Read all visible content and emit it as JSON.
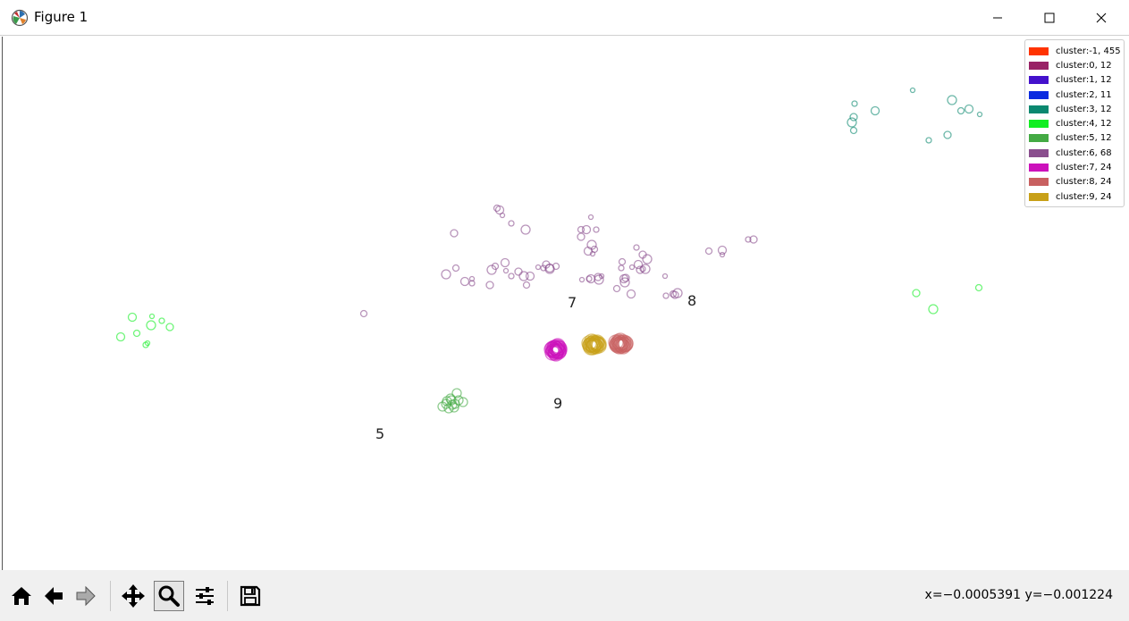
{
  "window": {
    "title": "Figure 1",
    "app_icon": "matplotlib-icon",
    "controls": [
      "minimize-icon",
      "maximize-icon",
      "close-icon"
    ]
  },
  "legend": [
    {
      "label": "cluster:-1, 455",
      "color": "#ff3300"
    },
    {
      "label": "cluster:0, 12",
      "color": "#992266"
    },
    {
      "label": "cluster:1, 12",
      "color": "#4411cc"
    },
    {
      "label": "cluster:2, 11",
      "color": "#0a2be0"
    },
    {
      "label": "cluster:3, 12",
      "color": "#0b8870"
    },
    {
      "label": "cluster:4, 12",
      "color": "#11ee22"
    },
    {
      "label": "cluster:5, 12",
      "color": "#44aa44"
    },
    {
      "label": "cluster:6, 68",
      "color": "#8a4e8e"
    },
    {
      "label": "cluster:7, 24",
      "color": "#cc11bb"
    },
    {
      "label": "cluster:8, 24",
      "color": "#c86060"
    },
    {
      "label": "cluster:9, 24",
      "color": "#c8a018"
    }
  ],
  "cluster_labels": [
    {
      "text": "7",
      "name": "cluster-label-7"
    },
    {
      "text": "8",
      "name": "cluster-label-8"
    },
    {
      "text": "9",
      "name": "cluster-label-9"
    },
    {
      "text": "5",
      "name": "cluster-label-5"
    }
  ],
  "toolbar": {
    "buttons": [
      "home-icon",
      "back-icon",
      "forward-icon",
      "pan-icon",
      "zoom-icon",
      "configure-icon",
      "save-icon"
    ],
    "active": "zoom-icon"
  },
  "status": {
    "coords": "x=−0.0005391 y=−0.001224"
  },
  "chart_data": {
    "type": "scatter",
    "title": "",
    "xlabel": "",
    "ylabel": "",
    "marker": "open-circle",
    "series": [
      {
        "color": "#0b8870",
        "points": [
          [
            953,
            116
          ],
          [
            952,
            131
          ],
          [
            950,
            137
          ],
          [
            952,
            146
          ],
          [
            976,
            124
          ],
          [
            1018,
            101
          ],
          [
            1036,
            157
          ],
          [
            1057,
            151
          ],
          [
            1062,
            112
          ],
          [
            1072,
            124
          ],
          [
            1081,
            122
          ],
          [
            1093,
            128
          ]
        ]
      },
      {
        "color": "#11ee22",
        "points": [
          [
            1022,
            328
          ],
          [
            1041,
            346
          ],
          [
            1092,
            322
          ],
          [
            145,
            355
          ],
          [
            167,
            354
          ],
          [
            178,
            359
          ],
          [
            187,
            366
          ],
          [
            166,
            364
          ],
          [
            150,
            373
          ],
          [
            132,
            377
          ],
          [
            162,
            384
          ],
          [
            160,
            386
          ]
        ]
      },
      {
        "color": "#44aa44",
        "points": [
          [
            496,
            452
          ],
          [
            502,
            448
          ],
          [
            508,
            440
          ],
          [
            515,
            450
          ],
          [
            499,
            457
          ],
          [
            505,
            456
          ],
          [
            492,
            455
          ],
          [
            510,
            448
          ],
          [
            503,
            453
          ],
          [
            497,
            449
          ],
          [
            506,
            452
          ],
          [
            501,
            446
          ]
        ]
      },
      {
        "color": "#8a4e8e",
        "points": [
          [
            553,
            233
          ],
          [
            556,
            235
          ],
          [
            559,
            241
          ],
          [
            569,
            250
          ],
          [
            505,
            261
          ],
          [
            585,
            257
          ],
          [
            647,
            257
          ],
          [
            653,
            257
          ],
          [
            658,
            243
          ],
          [
            664,
            257
          ],
          [
            647,
            265
          ],
          [
            659,
            274
          ],
          [
            662,
            279
          ],
          [
            655,
            281
          ],
          [
            660,
            284
          ],
          [
            709,
            277
          ],
          [
            716,
            285
          ],
          [
            721,
            290
          ],
          [
            693,
            293
          ],
          [
            711,
            296
          ],
          [
            704,
            299
          ],
          [
            716,
            301
          ],
          [
            697,
            311
          ],
          [
            696,
            316
          ],
          [
            687,
            323
          ],
          [
            703,
            329
          ],
          [
            741,
            309
          ],
          [
            742,
            331
          ],
          [
            752,
            330
          ],
          [
            755,
            328
          ],
          [
            790,
            281
          ],
          [
            805,
            280
          ],
          [
            805,
            285
          ],
          [
            834,
            268
          ],
          [
            840,
            268
          ],
          [
            496,
            307
          ],
          [
            507,
            300
          ],
          [
            517,
            315
          ],
          [
            525,
            312
          ],
          [
            525,
            317
          ],
          [
            545,
            319
          ],
          [
            547,
            302
          ],
          [
            551,
            298
          ],
          [
            562,
            294
          ],
          [
            563,
            303
          ],
          [
            569,
            309
          ],
          [
            577,
            304
          ],
          [
            583,
            309
          ],
          [
            586,
            319
          ],
          [
            590,
            309
          ],
          [
            599,
            299
          ],
          [
            605,
            300
          ],
          [
            608,
            296
          ],
          [
            612,
            301
          ],
          [
            619,
            298
          ],
          [
            612,
            300
          ],
          [
            648,
            313
          ],
          [
            656,
            312
          ],
          [
            666,
            310
          ],
          [
            667,
            313
          ],
          [
            404,
            351
          ],
          [
            658,
            312
          ],
          [
            670,
            309
          ],
          [
            692,
            300
          ],
          [
            713,
            302
          ],
          [
            719,
            301
          ],
          [
            750,
            329
          ],
          [
            695,
            312
          ]
        ]
      },
      {
        "color": "#cc11bb",
        "points": [
          [
            618,
            393
          ],
          [
            621,
            390
          ],
          [
            615,
            395
          ],
          [
            620,
            388
          ],
          [
            623,
            392
          ],
          [
            617,
            389
          ],
          [
            619,
            396
          ],
          [
            622,
            394
          ],
          [
            614,
            391
          ],
          [
            621,
            387
          ],
          [
            616,
            393
          ],
          [
            620,
            391
          ],
          [
            618,
            389
          ],
          [
            623,
            390
          ],
          [
            619,
            394
          ],
          [
            617,
            392
          ],
          [
            620,
            393
          ],
          [
            622,
            389
          ],
          [
            615,
            390
          ],
          [
            618,
            395
          ],
          [
            621,
            392
          ],
          [
            619,
            390
          ],
          [
            616,
            391
          ],
          [
            622,
            393
          ]
        ]
      },
      {
        "color": "#c86060",
        "points": [
          [
            690,
            385
          ],
          [
            693,
            383
          ],
          [
            687,
            386
          ],
          [
            695,
            386
          ],
          [
            691,
            381
          ],
          [
            688,
            384
          ],
          [
            694,
            388
          ],
          [
            690,
            388
          ],
          [
            697,
            384
          ],
          [
            686,
            383
          ],
          [
            692,
            386
          ],
          [
            689,
            382
          ],
          [
            695,
            383
          ],
          [
            691,
            385
          ],
          [
            688,
            387
          ],
          [
            693,
            387
          ],
          [
            696,
            386
          ],
          [
            690,
            383
          ],
          [
            687,
            385
          ],
          [
            692,
            384
          ],
          [
            694,
            385
          ],
          [
            689,
            386
          ],
          [
            691,
            387
          ],
          [
            697,
            385
          ]
        ]
      },
      {
        "color": "#c8a018",
        "points": [
          [
            660,
            386
          ],
          [
            663,
            384
          ],
          [
            657,
            387
          ],
          [
            665,
            385
          ],
          [
            661,
            383
          ],
          [
            658,
            389
          ],
          [
            664,
            388
          ],
          [
            660,
            389
          ],
          [
            667,
            385
          ],
          [
            656,
            384
          ],
          [
            662,
            386
          ],
          [
            659,
            382
          ],
          [
            665,
            383
          ],
          [
            661,
            387
          ],
          [
            658,
            385
          ],
          [
            663,
            387
          ],
          [
            666,
            386
          ],
          [
            660,
            384
          ],
          [
            657,
            386
          ],
          [
            662,
            385
          ],
          [
            664,
            384
          ],
          [
            659,
            386
          ],
          [
            661,
            388
          ],
          [
            667,
            387
          ]
        ]
      }
    ]
  }
}
